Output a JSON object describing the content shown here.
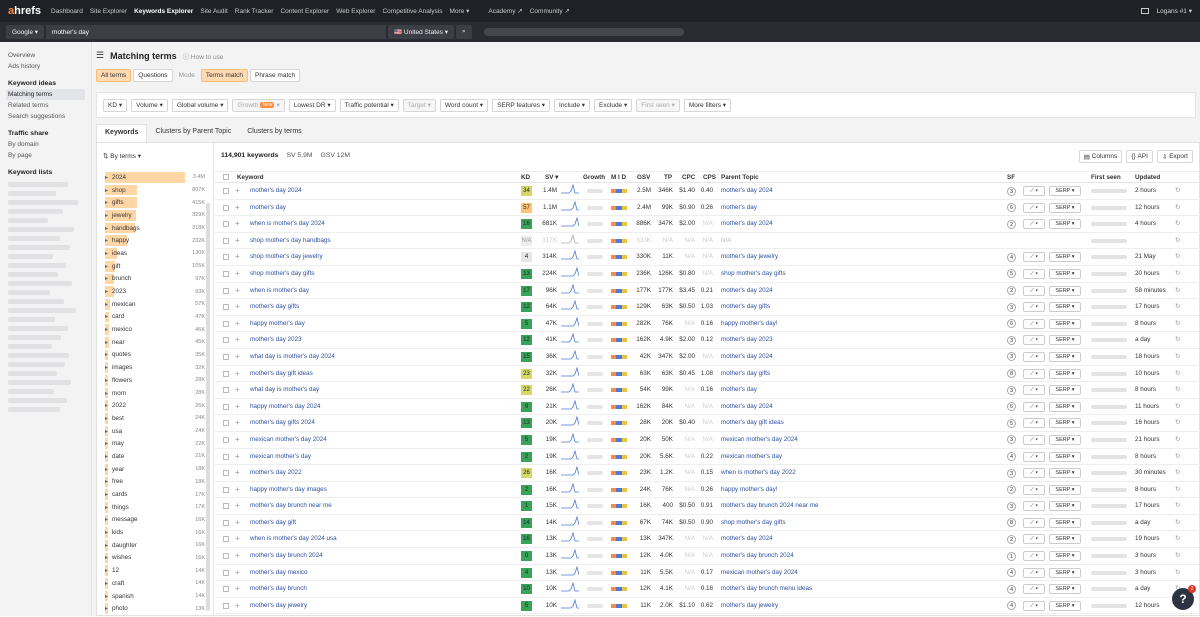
{
  "nav": {
    "logo_a": "a",
    "logo_rest": "hrefs",
    "items": [
      "Dashboard",
      "Site Explorer",
      "Keywords Explorer",
      "Site Audit",
      "Rank Tracker",
      "Content Explorer",
      "Web Explorer",
      "Competitive Analysis",
      "More ▾",
      "Academy ↗",
      "Community ↗"
    ],
    "user": "Logans #1 ▾"
  },
  "search": {
    "engine": "Google ▾",
    "query": "mother's day",
    "country": "🇺🇸 United States ▾",
    "search_icon": "⌕"
  },
  "sidebar": {
    "top": [
      "Overview",
      "Ads history"
    ],
    "ideas_head": "Keyword ideas",
    "ideas": [
      "Matching terms",
      "Related terms",
      "Search suggestions"
    ],
    "traffic_head": "Traffic share",
    "traffic": [
      "By domain",
      "By page"
    ],
    "lists_head": "Keyword lists"
  },
  "page": {
    "title": "Matching terms",
    "howto": "How to use"
  },
  "modes": [
    "All terms",
    "Questions",
    "Mode",
    "Terms match",
    "Phrase match"
  ],
  "filters": [
    "KD ▾",
    "Volume ▾",
    "Global volume ▾",
    "Growth",
    "Lowest DR ▾",
    "Traffic potential ▾",
    "Target ▾",
    "Word count ▾",
    "SERP features ▾",
    "Include ▾",
    "Exclude ▾",
    "First seen ▾",
    "More filters ▾"
  ],
  "new_badge": "New",
  "tabs": [
    "Keywords",
    "Clusters by Parent Topic",
    "Clusters by terms"
  ],
  "terms": {
    "by": "By terms ▾",
    "items": [
      [
        "2024",
        "3.4M"
      ],
      [
        "shop",
        "807K"
      ],
      [
        "gifts",
        "415K"
      ],
      [
        "jewelry",
        "329K"
      ],
      [
        "handbags",
        "318K"
      ],
      [
        "happy",
        "232K"
      ],
      [
        "ideas",
        "130K"
      ],
      [
        "gift",
        "105K"
      ],
      [
        "brunch",
        "97K"
      ],
      [
        "2023",
        "93K"
      ],
      [
        "mexican",
        "57K"
      ],
      [
        "card",
        "47K"
      ],
      [
        "mexico",
        "46K"
      ],
      [
        "near",
        "45K"
      ],
      [
        "quotes",
        "35K"
      ],
      [
        "images",
        "32K"
      ],
      [
        "flowers",
        "28K"
      ],
      [
        "mom",
        "28K"
      ],
      [
        "2022",
        "26K"
      ],
      [
        "best",
        "24K"
      ],
      [
        "usa",
        "24K"
      ],
      [
        "may",
        "22K"
      ],
      [
        "date",
        "21K"
      ],
      [
        "year",
        "18K"
      ],
      [
        "free",
        "18K"
      ],
      [
        "cards",
        "17K"
      ],
      [
        "things",
        "17K"
      ],
      [
        "message",
        "16K"
      ],
      [
        "kids",
        "16K"
      ],
      [
        "daughter",
        "16K"
      ],
      [
        "wishes",
        "16K"
      ],
      [
        "12",
        "14K"
      ],
      [
        "craft",
        "14K"
      ],
      [
        "spanish",
        "14K"
      ],
      [
        "photo",
        "13K"
      ]
    ]
  },
  "summary": {
    "count": "114,901 keywords",
    "sv": "SV 5.9M",
    "gsv": "GSV 12M"
  },
  "actions": {
    "columns": "Columns",
    "api": "API",
    "export": "Export"
  },
  "headers": {
    "keyword": "Keyword",
    "kd": "KD",
    "sv": "SV ▾",
    "growth": "Growth",
    "mlcd": "M I D",
    "gsv": "GSV",
    "tp": "TP",
    "cpc": "CPC",
    "cps": "CPS",
    "pt": "Parent Topic",
    "sf": "SF",
    "firstseen": "First seen",
    "updated": "Updated"
  },
  "colors": {
    "kd_green": "#2e9e4c",
    "kd_yellow": "#c9c93a",
    "kd_orange": "#ff8a3d"
  },
  "rows": [
    {
      "kw": "mother's day 2024",
      "kd": "34",
      "kdc": "#d5d96a",
      "sv": "1.4M",
      "gsv": "2.5M",
      "tp": "346K",
      "cpc": "$1.40",
      "cps": "0.40",
      "pt": "mother's day 2024",
      "sf": "3",
      "upd": "2 hours"
    },
    {
      "kw": "mother's day",
      "kd": "57",
      "kdc": "#ffc476",
      "sv": "1.1M",
      "gsv": "2.4M",
      "tp": "99K",
      "cpc": "$0.90",
      "cps": "0.26",
      "pt": "mother's day",
      "sf": "6",
      "upd": "12 hours"
    },
    {
      "kw": "when is mother's day 2024",
      "kd": "16",
      "kdc": "#3aa35a",
      "sv": "681K",
      "gsv": "886K",
      "tp": "347K",
      "cpc": "$2.00",
      "cps": "N/A",
      "pt": "mother's day 2024",
      "sf": "2",
      "upd": "4 hours"
    },
    {
      "kw": "shop mother's day handbags",
      "kd": "N/A",
      "kdc": "#eeeeee",
      "sv": "317K",
      "gsv": "333K",
      "tp": "N/A",
      "cpc": "N/A",
      "cps": "N/A",
      "pt": "N/A",
      "sf": "",
      "upd": ""
    },
    {
      "kw": "shop mother's day jewelry",
      "kd": "4",
      "kdc": "#e6e6e6",
      "sv": "314K",
      "gsv": "330K",
      "tp": "11K",
      "cpc": "N/A",
      "cps": "N/A",
      "pt": "mother's day jewelry",
      "sf": "4",
      "upd": "21 May"
    },
    {
      "kw": "shop mother's day gifts",
      "kd": "13",
      "kdc": "#3aa35a",
      "sv": "224K",
      "gsv": "236K",
      "tp": "126K",
      "cpc": "$0.80",
      "cps": "N/A",
      "pt": "shop mother's day gifts",
      "sf": "5",
      "upd": "20 hours"
    },
    {
      "kw": "when is mother's day",
      "kd": "17",
      "kdc": "#3aa35a",
      "sv": "96K",
      "gsv": "177K",
      "tp": "177K",
      "cpc": "$3.45",
      "cps": "0.21",
      "pt": "mother's day 2024",
      "sf": "2",
      "upd": "58 minutes"
    },
    {
      "kw": "mother's day gifts",
      "kd": "12",
      "kdc": "#3aa35a",
      "sv": "64K",
      "gsv": "129K",
      "tp": "63K",
      "cpc": "$0.50",
      "cps": "1.03",
      "pt": "mother's day gifts",
      "sf": "3",
      "upd": "17 hours"
    },
    {
      "kw": "happy mother's day",
      "kd": "5",
      "kdc": "#3aa35a",
      "sv": "47K",
      "gsv": "282K",
      "tp": "76K",
      "cpc": "N/A",
      "cps": "0.16",
      "pt": "happy mother's day!",
      "sf": "6",
      "upd": "8 hours"
    },
    {
      "kw": "mother's day 2023",
      "kd": "12",
      "kdc": "#3aa35a",
      "sv": "41K",
      "gsv": "162K",
      "tp": "4.9K",
      "cpc": "$2.00",
      "cps": "0.12",
      "pt": "mother's day 2023",
      "sf": "3",
      "upd": "a day"
    },
    {
      "kw": "what day is mother's day 2024",
      "kd": "15",
      "kdc": "#3aa35a",
      "sv": "36K",
      "gsv": "42K",
      "tp": "347K",
      "cpc": "$2.00",
      "cps": "N/A",
      "pt": "mother's day 2024",
      "sf": "3",
      "upd": "18 hours"
    },
    {
      "kw": "mother's day gift ideas",
      "kd": "23",
      "kdc": "#d5d96a",
      "sv": "32K",
      "gsv": "63K",
      "tp": "63K",
      "cpc": "$0.45",
      "cps": "1.08",
      "pt": "mother's day gifts",
      "sf": "8",
      "upd": "10 hours"
    },
    {
      "kw": "what day is mother's day",
      "kd": "22",
      "kdc": "#d5d96a",
      "sv": "26K",
      "gsv": "54K",
      "tp": "99K",
      "cpc": "N/A",
      "cps": "0.16",
      "pt": "mother's day",
      "sf": "3",
      "upd": "8 hours"
    },
    {
      "kw": "happy mother's day 2024",
      "kd": "9",
      "kdc": "#3aa35a",
      "sv": "21K",
      "gsv": "162K",
      "tp": "84K",
      "cpc": "N/A",
      "cps": "N/A",
      "pt": "mother's day 2024",
      "sf": "6",
      "upd": "11 hours"
    },
    {
      "kw": "mother's day gifts 2024",
      "kd": "13",
      "kdc": "#3aa35a",
      "sv": "20K",
      "gsv": "28K",
      "tp": "20K",
      "cpc": "$0.40",
      "cps": "N/A",
      "pt": "mother's day gift ideas",
      "sf": "5",
      "upd": "16 hours"
    },
    {
      "kw": "mexican mother's day 2024",
      "kd": "5",
      "kdc": "#3aa35a",
      "sv": "19K",
      "gsv": "20K",
      "tp": "50K",
      "cpc": "N/A",
      "cps": "N/A",
      "pt": "mexican mother's day 2024",
      "sf": "3",
      "upd": "21 hours"
    },
    {
      "kw": "mexican mother's day",
      "kd": "2",
      "kdc": "#3aa35a",
      "sv": "19K",
      "gsv": "20K",
      "tp": "5.6K",
      "cpc": "N/A",
      "cps": "0.22",
      "pt": "mexican mother's day",
      "sf": "4",
      "upd": "8 hours"
    },
    {
      "kw": "mother's day 2022",
      "kd": "26",
      "kdc": "#d5d96a",
      "sv": "16K",
      "gsv": "23K",
      "tp": "1.2K",
      "cpc": "N/A",
      "cps": "0.15",
      "pt": "when is mother's day 2022",
      "sf": "3",
      "upd": "30 minutes"
    },
    {
      "kw": "happy mother's day images",
      "kd": "2",
      "kdc": "#3aa35a",
      "sv": "16K",
      "gsv": "24K",
      "tp": "76K",
      "cpc": "N/A",
      "cps": "0.26",
      "pt": "happy mother's day!",
      "sf": "2",
      "upd": "8 hours"
    },
    {
      "kw": "mother's day brunch near me",
      "kd": "1",
      "kdc": "#3aa35a",
      "sv": "15K",
      "gsv": "16K",
      "tp": "400",
      "cpc": "$0.50",
      "cps": "0.91",
      "pt": "mother's day brunch 2024 near me",
      "sf": "3",
      "upd": "17 hours"
    },
    {
      "kw": "mother's day gift",
      "kd": "14",
      "kdc": "#3aa35a",
      "sv": "14K",
      "gsv": "67K",
      "tp": "74K",
      "cpc": "$0.50",
      "cps": "0.90",
      "pt": "shop mother's day gifts",
      "sf": "8",
      "upd": "a day"
    },
    {
      "kw": "when is mother's day 2024 usa",
      "kd": "16",
      "kdc": "#3aa35a",
      "sv": "13K",
      "gsv": "13K",
      "tp": "347K",
      "cpc": "N/A",
      "cps": "N/A",
      "pt": "mother's day 2024",
      "sf": "2",
      "upd": "19 hours"
    },
    {
      "kw": "mother's day brunch 2024",
      "kd": "0",
      "kdc": "#3aa35a",
      "sv": "13K",
      "gsv": "12K",
      "tp": "4.0K",
      "cpc": "N/A",
      "cps": "N/A",
      "pt": "mother's day brunch 2024",
      "sf": "1",
      "upd": "3 hours"
    },
    {
      "kw": "mother's day mexico",
      "kd": "4",
      "kdc": "#3aa35a",
      "sv": "13K",
      "gsv": "11K",
      "tp": "5.5K",
      "cpc": "N/A",
      "cps": "0.17",
      "pt": "mexican mother's day 2024",
      "sf": "4",
      "upd": "3 hours"
    },
    {
      "kw": "mother's day brunch",
      "kd": "10",
      "kdc": "#3aa35a",
      "sv": "10K",
      "gsv": "12K",
      "tp": "4.1K",
      "cpc": "N/A",
      "cps": "0.18",
      "pt": "mother's day brunch menu ideas",
      "sf": "4",
      "upd": "a day"
    },
    {
      "kw": "mother's day jewelry",
      "kd": "5",
      "kdc": "#3aa35a",
      "sv": "10K",
      "gsv": "11K",
      "tp": "2.0K",
      "cpc": "$1.10",
      "cps": "0.62",
      "pt": "mother's day jewelry",
      "sf": "4",
      "upd": "12 hours"
    }
  ],
  "trend_label": "⟋ ▾",
  "serp_label": "SERP ▾",
  "refresh": "↻",
  "help": "?",
  "help_badge": "2"
}
